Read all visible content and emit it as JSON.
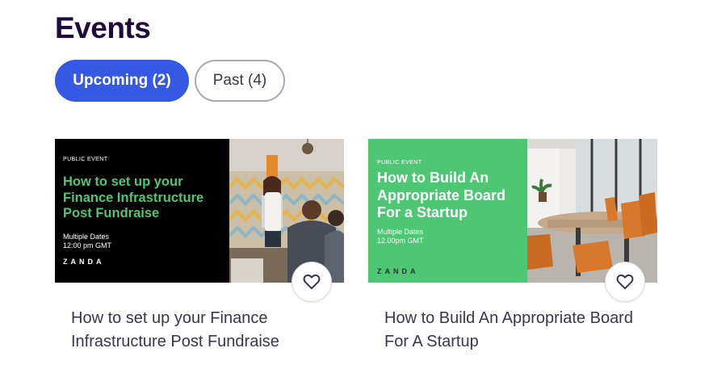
{
  "page": {
    "title": "Events"
  },
  "tabs": {
    "upcoming_label": "Upcoming (2)",
    "past_label": "Past (4)"
  },
  "events": [
    {
      "banner": {
        "tag": "PUBLIC EVENT",
        "title": "How to set up your Finance Infrastructure Post Fundraise",
        "dates_line1": "Multiple Dates",
        "dates_line2": "12:00 pm GMT",
        "logo": "ZANDA"
      },
      "title": "How to set up your Finance Infrastructure Post Fundraise",
      "save_icon": "heart-icon"
    },
    {
      "banner": {
        "tag": "PUBLIC EVENT",
        "title": "How to Build An Appropriate Board For a Startup",
        "dates_line1": "Multiple Dates",
        "dates_line2": "12.00pm GMT",
        "logo": "ZANDA"
      },
      "title": "How to Build An Appropriate Board For A Startup",
      "save_icon": "heart-icon"
    }
  ],
  "colors": {
    "heading": "#1e0a3c",
    "tab_active_bg": "#3659e3",
    "banner_green": "#4dc771",
    "text": "#39364f"
  }
}
